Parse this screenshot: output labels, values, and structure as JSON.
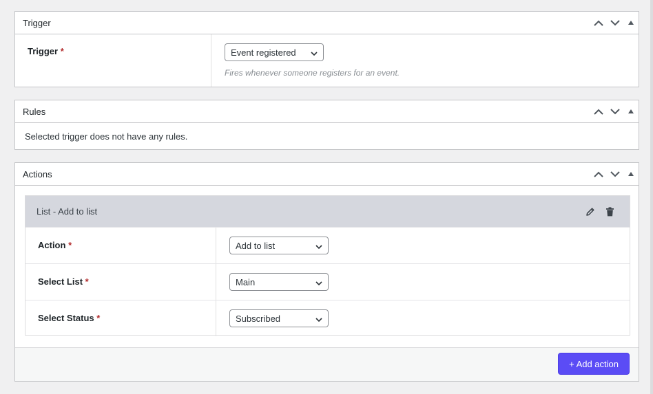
{
  "trigger_box": {
    "title": "Trigger",
    "field_label": "Trigger",
    "required_mark": "*",
    "selected_value": "Event registered",
    "description": "Fires whenever someone registers for an event."
  },
  "rules_box": {
    "title": "Rules",
    "message": "Selected trigger does not have any rules."
  },
  "actions_box": {
    "title": "Actions",
    "card": {
      "title": "List - Add to list",
      "fields": [
        {
          "label": "Action",
          "required_mark": "*",
          "value": "Add to list"
        },
        {
          "label": "Select List",
          "required_mark": "*",
          "value": "Main"
        },
        {
          "label": "Select Status",
          "required_mark": "*",
          "value": "Subscribed"
        }
      ]
    },
    "add_button_label": "+ Add action"
  },
  "colors": {
    "accent": "#5b4cf5",
    "required": "#b32d2e",
    "card_header": "#d5d7de"
  },
  "icons": [
    "chevron-up-icon",
    "chevron-down-icon",
    "triangle-up-icon",
    "pencil-icon",
    "trash-icon"
  ]
}
